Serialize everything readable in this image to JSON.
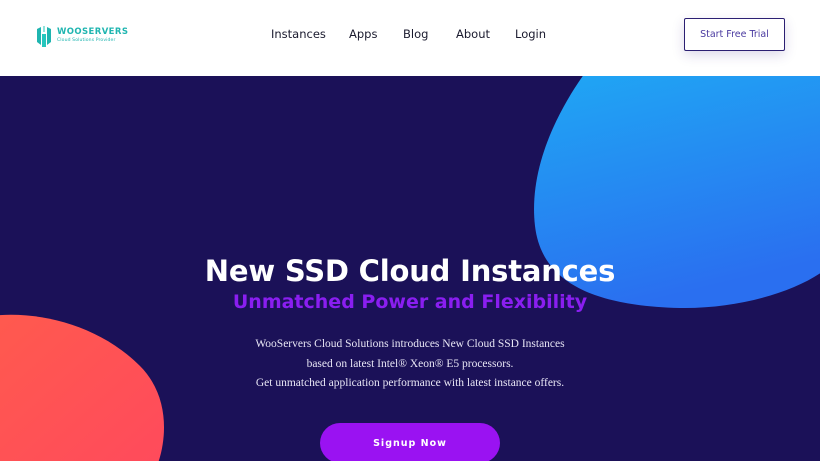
{
  "brand": {
    "name": "WOOSERVERS",
    "tagline": "Cloud Solutions Provider",
    "color": "#1fb5b0"
  },
  "nav": {
    "items": [
      {
        "label": "Instances"
      },
      {
        "label": "Apps"
      },
      {
        "label": "Blog"
      },
      {
        "label": "About"
      },
      {
        "label": "Login"
      }
    ],
    "cta_label": "Start Free Trial"
  },
  "hero": {
    "title": "New SSD Cloud Instances",
    "subtitle": "Unmatched Power and Flexibility",
    "description": [
      "WooServers Cloud Solutions introduces New Cloud SSD Instances",
      "based on latest Intel® Xeon® E5 processors.",
      "Get unmatched application performance with latest instance offers."
    ],
    "button_label": "Signup Now"
  },
  "colors": {
    "hero_background": "#1b1158",
    "accent_purple": "#9a12f2",
    "blob_blue": "#1e8cf0",
    "blob_coral": "#ff4e50"
  }
}
